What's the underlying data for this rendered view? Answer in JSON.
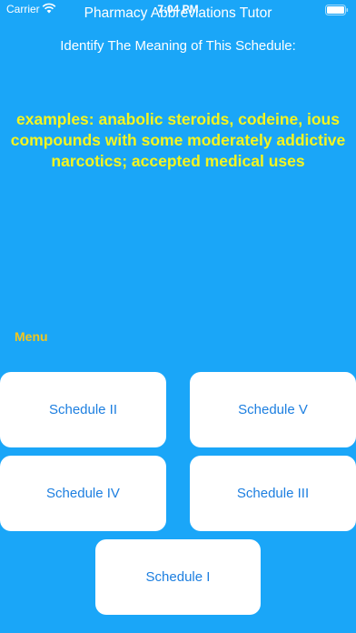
{
  "status_bar": {
    "carrier": "Carrier",
    "time": "7:04 PM",
    "wifi_icon": "wifi-icon",
    "battery_icon": "battery-icon"
  },
  "header": {
    "title": "Pharmacy Abbreviations Tutor"
  },
  "quiz": {
    "question": "Identify The Meaning of This Schedule:",
    "prompt": "examples: anabolic steroids, codeine, ious compounds with some moderately addictive narcotics; accepted medical uses"
  },
  "menu": {
    "label": "Menu"
  },
  "answers": [
    {
      "label": "Schedule II"
    },
    {
      "label": "Schedule V"
    },
    {
      "label": "Schedule IV"
    },
    {
      "label": "Schedule III"
    },
    {
      "label": "Schedule I"
    }
  ],
  "colors": {
    "background": "#1aa6f8",
    "prompt_text": "#f5f51f",
    "menu_text": "#f2c61e",
    "button_text": "#1d7fe0",
    "button_bg": "#ffffff"
  }
}
